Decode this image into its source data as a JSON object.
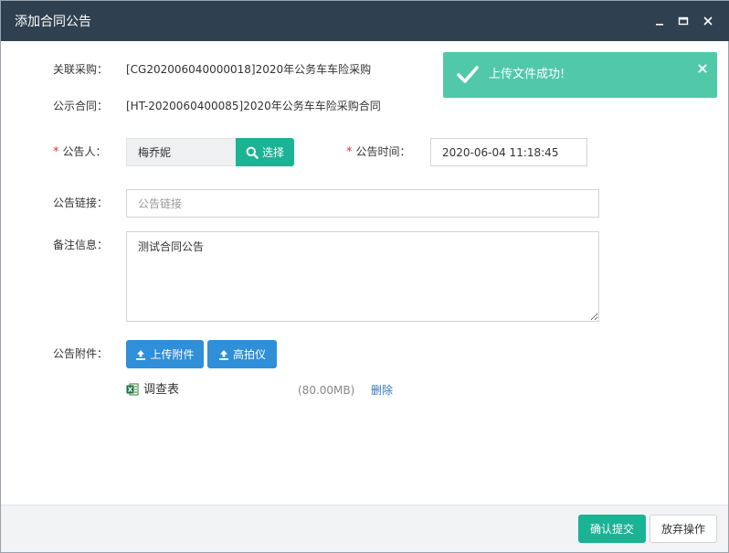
{
  "window": {
    "title": "添加合同公告"
  },
  "toast": {
    "message": "上传文件成功!"
  },
  "form": {
    "procurement_label": "关联采购：",
    "procurement_value": "[CG202006040000018]2020年公务车车险采购",
    "contract_label": "公示合同：",
    "contract_value": "[HT-2020060400085]2020年公务车车险采购合同",
    "announcer_label": "公告人：",
    "announcer_value": "梅乔妮",
    "select_button": "选择",
    "time_label": "公告时间：",
    "time_value": "2020-06-04 11:18:45",
    "link_label": "公告链接：",
    "link_placeholder": "公告链接",
    "remarks_label": "备注信息：",
    "remarks_value": "测试合同公告",
    "attachment_label": "公告附件：",
    "upload_button": "上传附件",
    "scanner_button": "高拍仪",
    "required_mark": "*"
  },
  "attachments": [
    {
      "name": "调查表",
      "size": "(80.00MB)",
      "delete_label": "删除"
    }
  ],
  "footer": {
    "confirm_button": "确认提交",
    "cancel_button": "放弃操作"
  },
  "colors": {
    "titlebar": "#2f4050",
    "teal": "#1ab394",
    "blue": "#2f8fd8",
    "toast": "#51c9a8",
    "required": "#e5322d",
    "link": "#337ab7"
  }
}
